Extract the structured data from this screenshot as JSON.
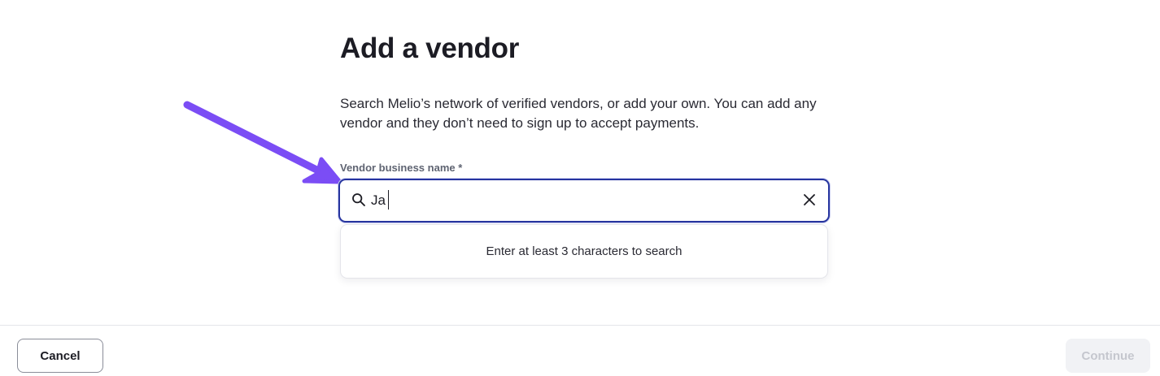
{
  "page": {
    "title": "Add a vendor",
    "description": "Search Melio’s network of verified vendors, or add your own. You can add any vendor and they don’t need to sign up to accept payments."
  },
  "vendor_field": {
    "label": "Vendor business name *",
    "value": "Ja",
    "search_icon": "search-icon",
    "clear_icon": "close-icon"
  },
  "dropdown": {
    "message": "Enter at least 3 characters to search"
  },
  "annotation": {
    "arrow_color": "#7b4df5"
  },
  "footer": {
    "cancel_label": "Cancel",
    "continue_label": "Continue"
  },
  "colors": {
    "focus_border": "#27359f",
    "disabled_button_bg": "#f1f2f5",
    "disabled_button_text": "#c5c7ce"
  }
}
